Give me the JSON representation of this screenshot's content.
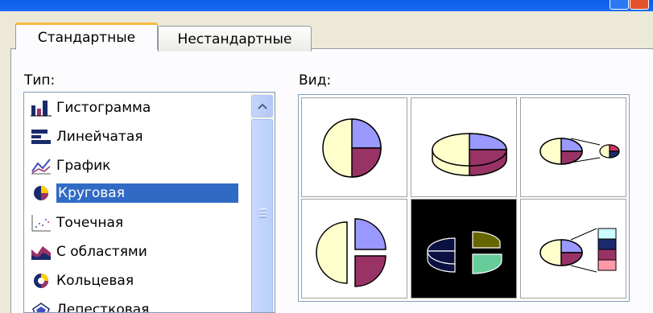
{
  "dialog": {
    "tabs": [
      {
        "label": "Стандартные",
        "active": true
      },
      {
        "label": "Нестандартные",
        "active": false
      }
    ],
    "type_label": "Тип:",
    "view_label": "Вид:",
    "chart_types": [
      {
        "label": "Гистограмма",
        "icon": "column-chart-icon"
      },
      {
        "label": "Линейчатая",
        "icon": "bar-chart-icon"
      },
      {
        "label": "График",
        "icon": "line-chart-icon"
      },
      {
        "label": "Круговая",
        "icon": "pie-chart-icon",
        "selected": true
      },
      {
        "label": "Точечная",
        "icon": "scatter-chart-icon"
      },
      {
        "label": "С областями",
        "icon": "area-chart-icon"
      },
      {
        "label": "Кольцевая",
        "icon": "doughnut-chart-icon"
      },
      {
        "label": "Лепестковая",
        "icon": "radar-chart-icon"
      }
    ],
    "subtypes": [
      {
        "name": "pie",
        "selected": false
      },
      {
        "name": "3d-pie",
        "selected": false
      },
      {
        "name": "pie-of-pie",
        "selected": false
      },
      {
        "name": "exploded-pie",
        "selected": false
      },
      {
        "name": "exploded-3d-pie",
        "selected": true
      },
      {
        "name": "bar-of-pie",
        "selected": false
      }
    ],
    "colors": {
      "selection": "#316ac5",
      "pie_cream": "#ffffcc",
      "pie_lavender": "#9999ff",
      "pie_maroon": "#993366"
    }
  }
}
